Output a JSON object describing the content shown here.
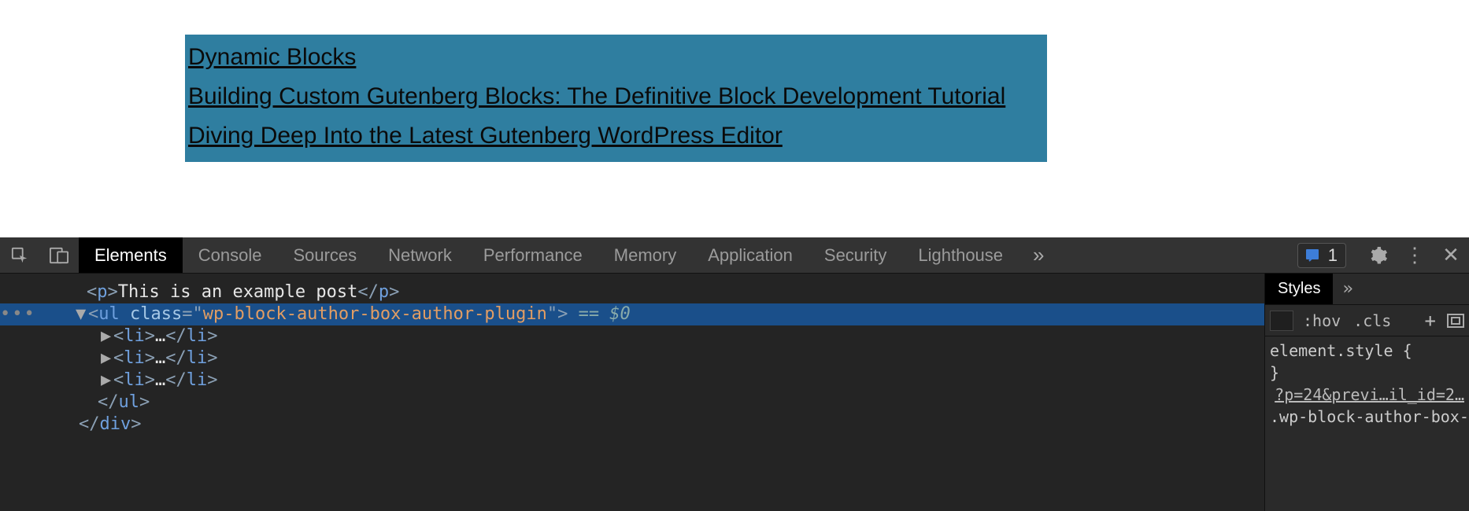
{
  "page": {
    "links": [
      "Dynamic Blocks",
      "Building Custom Gutenberg Blocks: The Definitive Block Development Tutorial",
      "Diving Deep Into the Latest Gutenberg WordPress Editor"
    ]
  },
  "devtools": {
    "tabs": [
      "Elements",
      "Console",
      "Sources",
      "Network",
      "Performance",
      "Memory",
      "Application",
      "Security",
      "Lighthouse"
    ],
    "active_tab": "Elements",
    "issues_count": "1",
    "styles": {
      "tabs": [
        "Styles"
      ],
      "hov": ":hov",
      "cls": ".cls",
      "element_style_open": "element.style {",
      "element_style_close": "}",
      "source_link": "?p=24&previ…il_id=2…",
      "rule_selector": ".wp-block-author-box-"
    },
    "dom": {
      "p_text": "This is an example post",
      "ul_class": "wp-block-author-box-author-plugin",
      "eq": " == $0"
    }
  }
}
